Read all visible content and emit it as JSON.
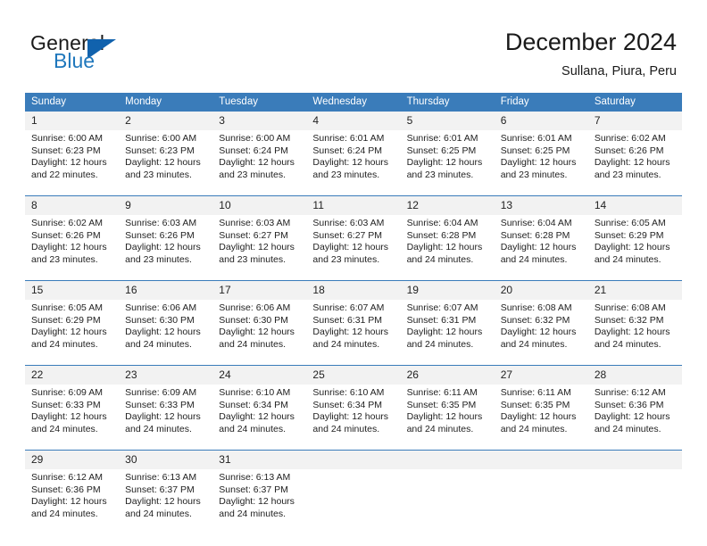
{
  "brand": {
    "name_primary": "General",
    "name_secondary": "Blue",
    "flag_icon": "triangle-flag-icon"
  },
  "header": {
    "title": "December 2024",
    "subtitle": "Sullana, Piura, Peru"
  },
  "colors": {
    "header_blue": "#3a7cba",
    "logo_blue": "#1f77bc",
    "flag_blue": "#1162ad",
    "daynum_bg": "#f2f2f2",
    "cell_bg": "#ffffff",
    "text": "#222222"
  },
  "calendar": {
    "weekday_headers": [
      "Sunday",
      "Monday",
      "Tuesday",
      "Wednesday",
      "Thursday",
      "Friday",
      "Saturday"
    ],
    "weeks": [
      [
        {
          "day": "1",
          "sunrise": "Sunrise: 6:00 AM",
          "sunset": "Sunset: 6:23 PM",
          "daylight1": "Daylight: 12 hours",
          "daylight2": "and 22 minutes."
        },
        {
          "day": "2",
          "sunrise": "Sunrise: 6:00 AM",
          "sunset": "Sunset: 6:23 PM",
          "daylight1": "Daylight: 12 hours",
          "daylight2": "and 23 minutes."
        },
        {
          "day": "3",
          "sunrise": "Sunrise: 6:00 AM",
          "sunset": "Sunset: 6:24 PM",
          "daylight1": "Daylight: 12 hours",
          "daylight2": "and 23 minutes."
        },
        {
          "day": "4",
          "sunrise": "Sunrise: 6:01 AM",
          "sunset": "Sunset: 6:24 PM",
          "daylight1": "Daylight: 12 hours",
          "daylight2": "and 23 minutes."
        },
        {
          "day": "5",
          "sunrise": "Sunrise: 6:01 AM",
          "sunset": "Sunset: 6:25 PM",
          "daylight1": "Daylight: 12 hours",
          "daylight2": "and 23 minutes."
        },
        {
          "day": "6",
          "sunrise": "Sunrise: 6:01 AM",
          "sunset": "Sunset: 6:25 PM",
          "daylight1": "Daylight: 12 hours",
          "daylight2": "and 23 minutes."
        },
        {
          "day": "7",
          "sunrise": "Sunrise: 6:02 AM",
          "sunset": "Sunset: 6:26 PM",
          "daylight1": "Daylight: 12 hours",
          "daylight2": "and 23 minutes."
        }
      ],
      [
        {
          "day": "8",
          "sunrise": "Sunrise: 6:02 AM",
          "sunset": "Sunset: 6:26 PM",
          "daylight1": "Daylight: 12 hours",
          "daylight2": "and 23 minutes."
        },
        {
          "day": "9",
          "sunrise": "Sunrise: 6:03 AM",
          "sunset": "Sunset: 6:26 PM",
          "daylight1": "Daylight: 12 hours",
          "daylight2": "and 23 minutes."
        },
        {
          "day": "10",
          "sunrise": "Sunrise: 6:03 AM",
          "sunset": "Sunset: 6:27 PM",
          "daylight1": "Daylight: 12 hours",
          "daylight2": "and 23 minutes."
        },
        {
          "day": "11",
          "sunrise": "Sunrise: 6:03 AM",
          "sunset": "Sunset: 6:27 PM",
          "daylight1": "Daylight: 12 hours",
          "daylight2": "and 23 minutes."
        },
        {
          "day": "12",
          "sunrise": "Sunrise: 6:04 AM",
          "sunset": "Sunset: 6:28 PM",
          "daylight1": "Daylight: 12 hours",
          "daylight2": "and 24 minutes."
        },
        {
          "day": "13",
          "sunrise": "Sunrise: 6:04 AM",
          "sunset": "Sunset: 6:28 PM",
          "daylight1": "Daylight: 12 hours",
          "daylight2": "and 24 minutes."
        },
        {
          "day": "14",
          "sunrise": "Sunrise: 6:05 AM",
          "sunset": "Sunset: 6:29 PM",
          "daylight1": "Daylight: 12 hours",
          "daylight2": "and 24 minutes."
        }
      ],
      [
        {
          "day": "15",
          "sunrise": "Sunrise: 6:05 AM",
          "sunset": "Sunset: 6:29 PM",
          "daylight1": "Daylight: 12 hours",
          "daylight2": "and 24 minutes."
        },
        {
          "day": "16",
          "sunrise": "Sunrise: 6:06 AM",
          "sunset": "Sunset: 6:30 PM",
          "daylight1": "Daylight: 12 hours",
          "daylight2": "and 24 minutes."
        },
        {
          "day": "17",
          "sunrise": "Sunrise: 6:06 AM",
          "sunset": "Sunset: 6:30 PM",
          "daylight1": "Daylight: 12 hours",
          "daylight2": "and 24 minutes."
        },
        {
          "day": "18",
          "sunrise": "Sunrise: 6:07 AM",
          "sunset": "Sunset: 6:31 PM",
          "daylight1": "Daylight: 12 hours",
          "daylight2": "and 24 minutes."
        },
        {
          "day": "19",
          "sunrise": "Sunrise: 6:07 AM",
          "sunset": "Sunset: 6:31 PM",
          "daylight1": "Daylight: 12 hours",
          "daylight2": "and 24 minutes."
        },
        {
          "day": "20",
          "sunrise": "Sunrise: 6:08 AM",
          "sunset": "Sunset: 6:32 PM",
          "daylight1": "Daylight: 12 hours",
          "daylight2": "and 24 minutes."
        },
        {
          "day": "21",
          "sunrise": "Sunrise: 6:08 AM",
          "sunset": "Sunset: 6:32 PM",
          "daylight1": "Daylight: 12 hours",
          "daylight2": "and 24 minutes."
        }
      ],
      [
        {
          "day": "22",
          "sunrise": "Sunrise: 6:09 AM",
          "sunset": "Sunset: 6:33 PM",
          "daylight1": "Daylight: 12 hours",
          "daylight2": "and 24 minutes."
        },
        {
          "day": "23",
          "sunrise": "Sunrise: 6:09 AM",
          "sunset": "Sunset: 6:33 PM",
          "daylight1": "Daylight: 12 hours",
          "daylight2": "and 24 minutes."
        },
        {
          "day": "24",
          "sunrise": "Sunrise: 6:10 AM",
          "sunset": "Sunset: 6:34 PM",
          "daylight1": "Daylight: 12 hours",
          "daylight2": "and 24 minutes."
        },
        {
          "day": "25",
          "sunrise": "Sunrise: 6:10 AM",
          "sunset": "Sunset: 6:34 PM",
          "daylight1": "Daylight: 12 hours",
          "daylight2": "and 24 minutes."
        },
        {
          "day": "26",
          "sunrise": "Sunrise: 6:11 AM",
          "sunset": "Sunset: 6:35 PM",
          "daylight1": "Daylight: 12 hours",
          "daylight2": "and 24 minutes."
        },
        {
          "day": "27",
          "sunrise": "Sunrise: 6:11 AM",
          "sunset": "Sunset: 6:35 PM",
          "daylight1": "Daylight: 12 hours",
          "daylight2": "and 24 minutes."
        },
        {
          "day": "28",
          "sunrise": "Sunrise: 6:12 AM",
          "sunset": "Sunset: 6:36 PM",
          "daylight1": "Daylight: 12 hours",
          "daylight2": "and 24 minutes."
        }
      ],
      [
        {
          "day": "29",
          "sunrise": "Sunrise: 6:12 AM",
          "sunset": "Sunset: 6:36 PM",
          "daylight1": "Daylight: 12 hours",
          "daylight2": "and 24 minutes."
        },
        {
          "day": "30",
          "sunrise": "Sunrise: 6:13 AM",
          "sunset": "Sunset: 6:37 PM",
          "daylight1": "Daylight: 12 hours",
          "daylight2": "and 24 minutes."
        },
        {
          "day": "31",
          "sunrise": "Sunrise: 6:13 AM",
          "sunset": "Sunset: 6:37 PM",
          "daylight1": "Daylight: 12 hours",
          "daylight2": "and 24 minutes."
        },
        {
          "day": "",
          "sunrise": "",
          "sunset": "",
          "daylight1": "",
          "daylight2": ""
        },
        {
          "day": "",
          "sunrise": "",
          "sunset": "",
          "daylight1": "",
          "daylight2": ""
        },
        {
          "day": "",
          "sunrise": "",
          "sunset": "",
          "daylight1": "",
          "daylight2": ""
        },
        {
          "day": "",
          "sunrise": "",
          "sunset": "",
          "daylight1": "",
          "daylight2": ""
        }
      ]
    ]
  }
}
